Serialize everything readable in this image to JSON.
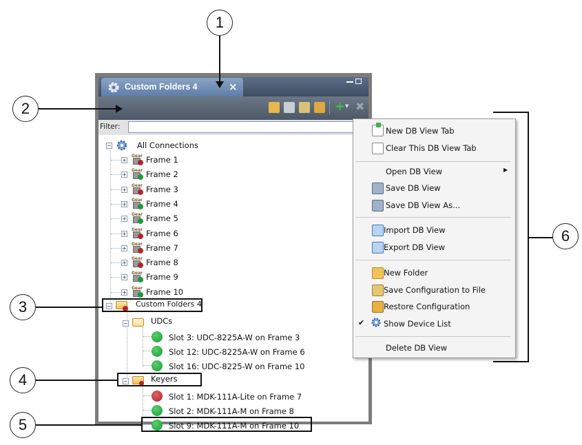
{
  "callouts": [
    "1",
    "2",
    "3",
    "4",
    "5",
    "6"
  ],
  "panel": {
    "tab_title": "Custom Folders 4",
    "tab_close": "×",
    "filter_label": "Filter:",
    "filter_value": ""
  },
  "tree": {
    "root": "All Connections",
    "frames": [
      "Frame 1",
      "Frame 2",
      "Frame 3",
      "Frame 4",
      "Frame 5",
      "Frame 6",
      "Frame 7",
      "Frame 8",
      "Frame 9",
      "Frame 10"
    ],
    "frame_status": [
      "red",
      "green",
      "red",
      "green",
      "green",
      "red",
      "red",
      "red",
      "green",
      "green"
    ],
    "custom_folder": "Custom Folders 4",
    "udcs_label": "UDCs",
    "udcs": [
      "Slot 3: UDC-8225A-W on Frame 3",
      "Slot 12: UDC-8225A-W on Frame 6",
      "Slot 16: UDC-8225-W on Frame 10"
    ],
    "keyers_label": "Keyers",
    "keyers": [
      "Slot 1: MDK-111A-Lite on Frame 7",
      "Slot 2: MDK-111A-M on Frame 8",
      "Slot 9: MDK-111A-M on Frame 10"
    ],
    "keyer_status": [
      "red",
      "green",
      "green"
    ]
  },
  "menu": {
    "new_tab": "New DB View Tab",
    "clear_tab": "Clear This DB View Tab",
    "open": "Open DB View",
    "save": "Save DB View",
    "save_as": "Save DB View As...",
    "import": "Import DB View",
    "export": "Export DB View",
    "new_folder": "New Folder",
    "save_config": "Save Configuration to File",
    "restore_config": "Restore Configuration",
    "show_device_list": "Show Device List",
    "delete": "Delete DB View",
    "check_mark": "✔",
    "submenu_arrow": "▶"
  },
  "colors": {
    "status_green": "#1a9a3a",
    "status_red": "#b3232b",
    "title_blue": "#5f7ea6"
  }
}
